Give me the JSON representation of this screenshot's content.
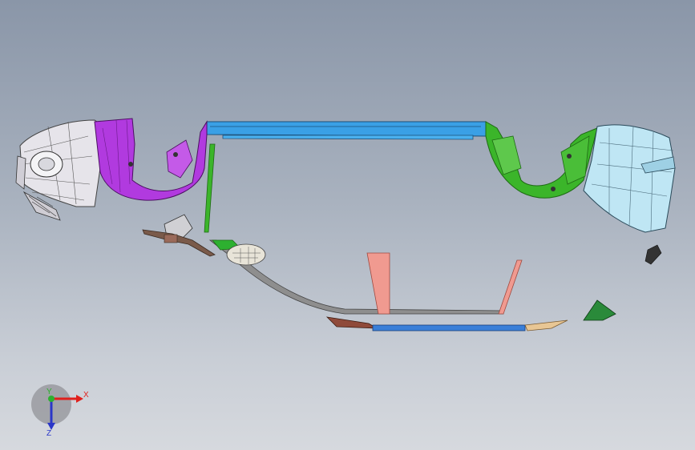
{
  "triad": {
    "x_label": "X",
    "y_label": "Y",
    "z_label": "Z",
    "x_color": "#e0201c",
    "y_color": "#2db030",
    "z_color": "#2a36c8"
  },
  "parts": {
    "left_corner_color": "#e6e4ea",
    "left_wheel_arch_color": "#b13adf",
    "beam_color": "#3aa0e6",
    "right_wheel_arch_color": "#3bb52a",
    "right_corner_color": "#bfe6f4",
    "lower_grille_color": "#8e8e8e",
    "bracket_color": "#f09a90",
    "lower_lip_color": "#3a7fd8",
    "lip_end_left_color": "#8f4a3a",
    "lip_end_right_color": "#e8c694",
    "fog_lamp_color": "#e8e4d8",
    "bracket_green_color": "#2a8a3a",
    "horn_color": "#7a5a4a"
  }
}
